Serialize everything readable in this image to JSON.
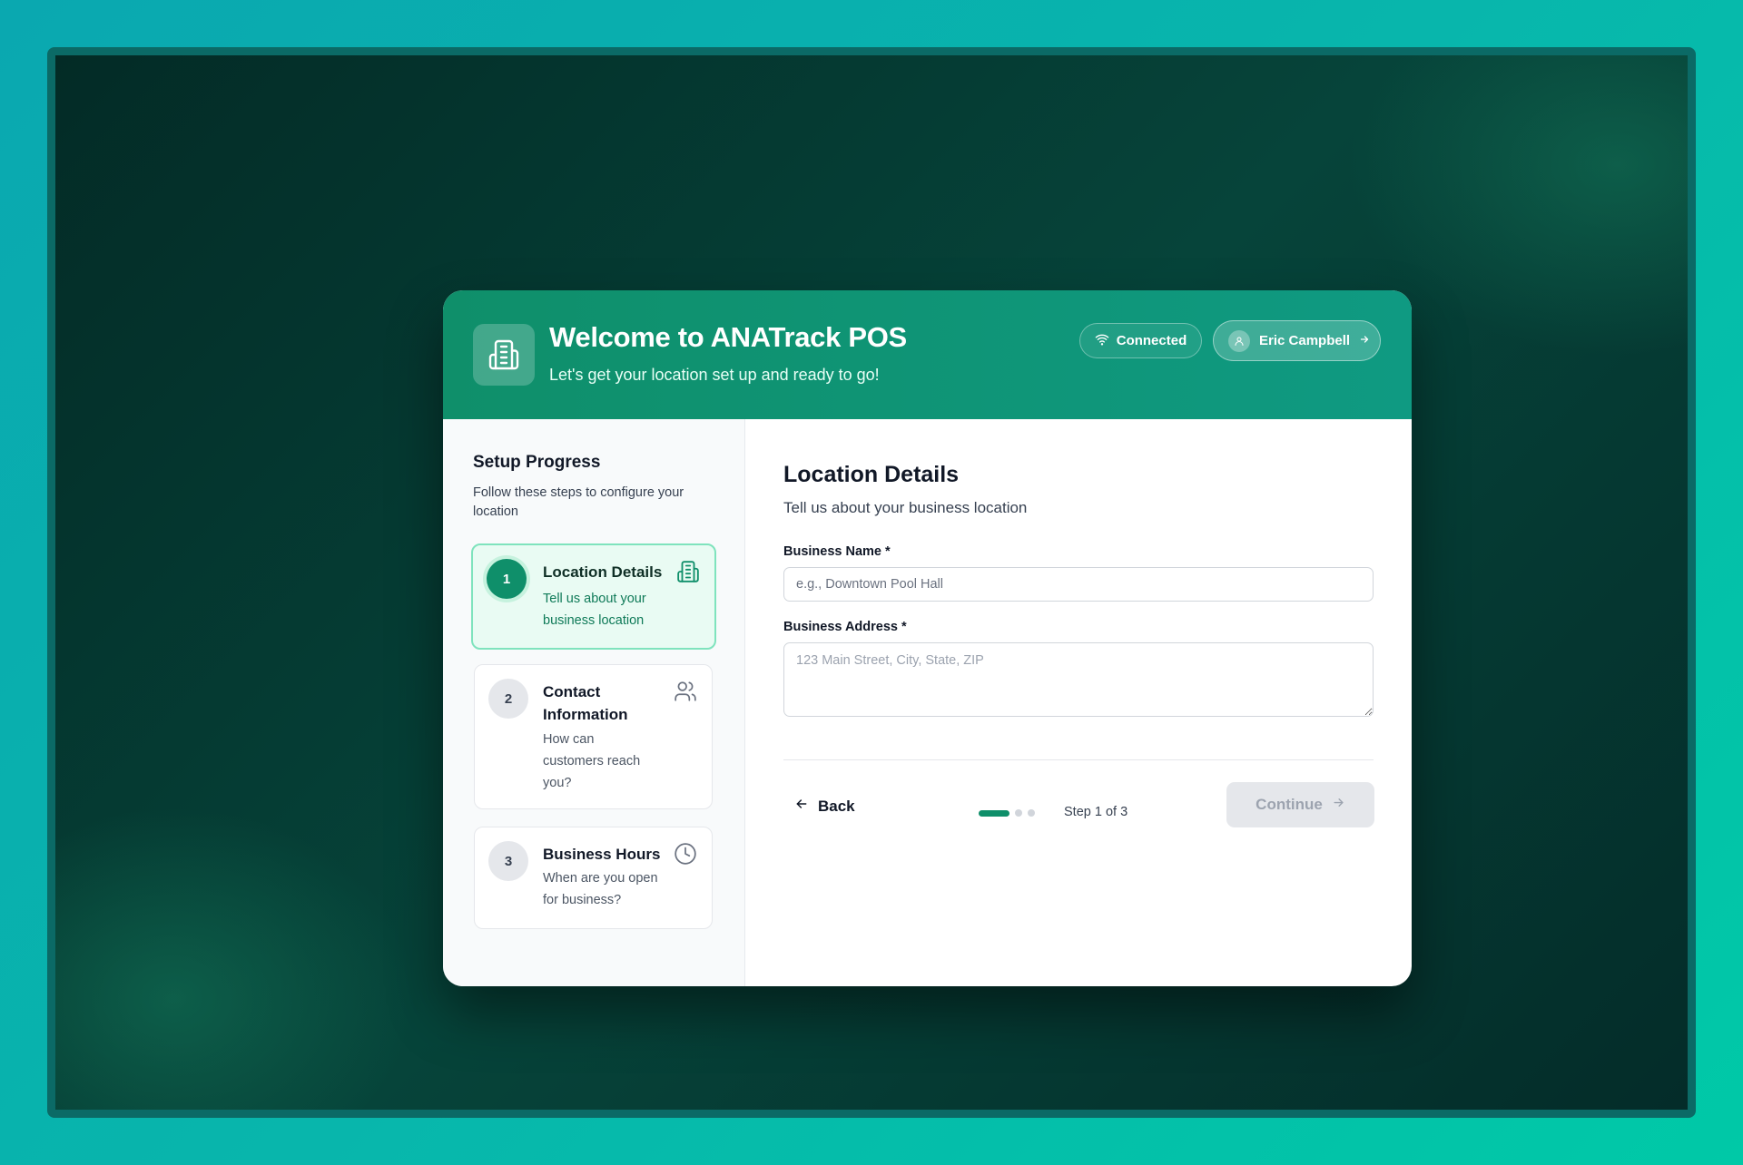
{
  "header": {
    "title": "Welcome to ANATrack POS",
    "subtitle": "Let's get your location set up and ready to go!",
    "connection_status": "Connected",
    "user_name": "Eric Campbell"
  },
  "sidebar": {
    "title": "Setup Progress",
    "subtitle": "Follow these steps to configure your location",
    "steps": [
      {
        "number": "1",
        "title": "Location Details",
        "description": "Tell us about your business location",
        "icon": "building-icon",
        "active": true
      },
      {
        "number": "2",
        "title": "Contact Information",
        "description": "How can customers reach you?",
        "icon": "users-icon",
        "active": false
      },
      {
        "number": "3",
        "title": "Business Hours",
        "description": "When are you open for business?",
        "icon": "clock-icon",
        "active": false
      }
    ]
  },
  "form": {
    "title": "Location Details",
    "subtitle": "Tell us about your business location",
    "business_name_label": "Business Name *",
    "business_name_placeholder": "e.g., Downtown Pool Hall",
    "business_name_value": "",
    "business_address_label": "Business Address *",
    "business_address_placeholder": "123 Main Street, City, State, ZIP",
    "business_address_value": ""
  },
  "footer": {
    "back_label": "Back",
    "step_indicator": "Step 1 of 3",
    "current_step": 1,
    "total_steps": 3,
    "continue_label": "Continue",
    "continue_enabled": false
  },
  "colors": {
    "accent": "#0f8f6a",
    "header_gradient_end": "#0f9a82",
    "active_step_bg": "#e9fbf3",
    "active_step_border": "#7fe3bd",
    "disabled_button_bg": "#e5e7eb"
  }
}
